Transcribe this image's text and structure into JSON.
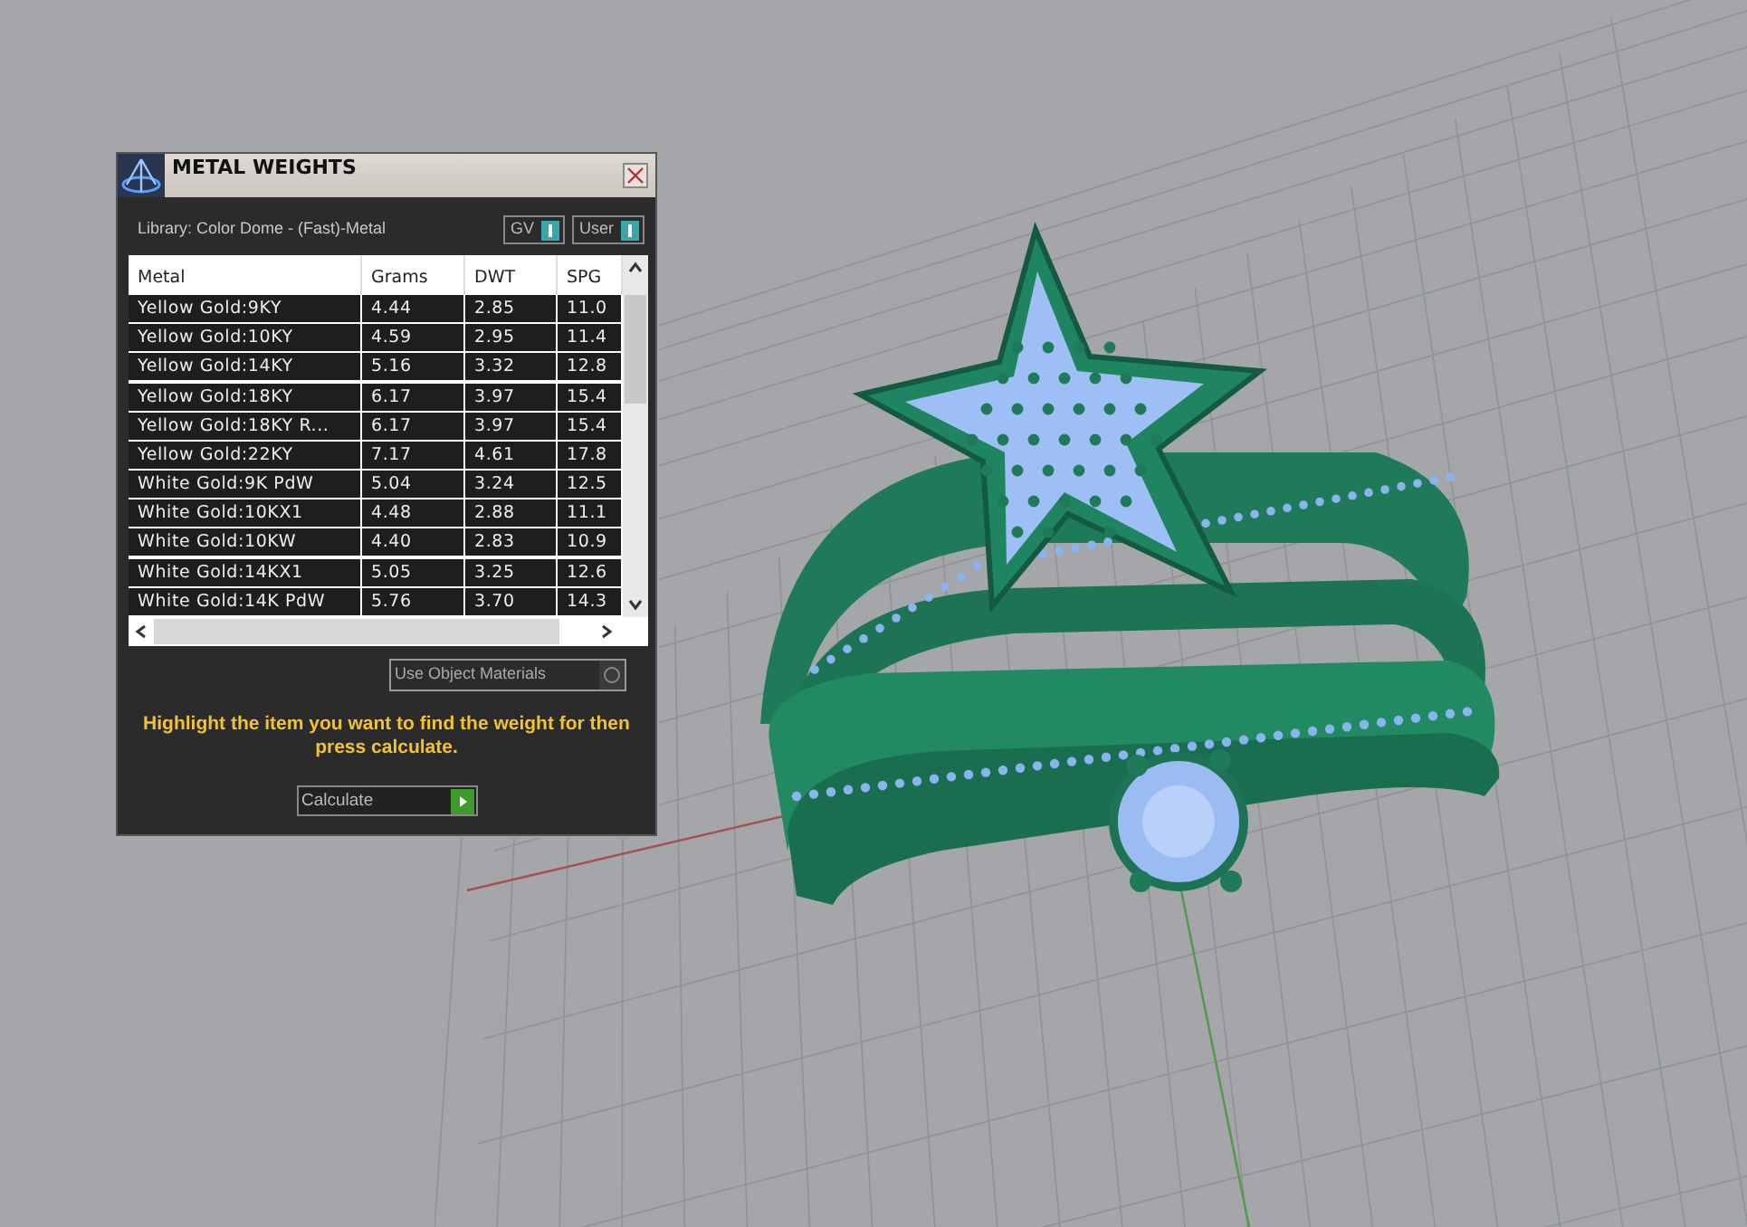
{
  "panel": {
    "title": "METAL WEIGHTS",
    "library": "Library: Color Dome - (Fast)-Metal",
    "toggles": [
      {
        "label": "GV",
        "on": true
      },
      {
        "label": "User",
        "on": true
      }
    ],
    "table": {
      "columns": [
        "Metal",
        "Grams",
        "DWT",
        "SPG"
      ],
      "rows": [
        {
          "cells": [
            "Yellow Gold:9KY",
            "4.44",
            "2.85",
            "11.0"
          ],
          "selected": false
        },
        {
          "cells": [
            "Yellow Gold:10KY",
            "4.59",
            "2.95",
            "11.4"
          ],
          "selected": false
        },
        {
          "cells": [
            "Yellow Gold:14KY",
            "5.16",
            "3.32",
            "12.8"
          ],
          "selected": false
        },
        {
          "cells": [
            "Yellow Gold:18KY",
            "6.17",
            "3.97",
            "15.4"
          ],
          "selected": false
        },
        {
          "cells": [
            "Yellow Gold:18KY R...",
            "6.17",
            "3.97",
            "15.4"
          ],
          "selected": false
        },
        {
          "cells": [
            "Yellow Gold:22KY",
            "7.17",
            "4.61",
            "17.8"
          ],
          "selected": false
        },
        {
          "cells": [
            "White Gold:9K PdW",
            "5.04",
            "3.24",
            "12.5"
          ],
          "selected": false
        },
        {
          "cells": [
            "White Gold:10KX1",
            "4.48",
            "2.88",
            "11.1"
          ],
          "selected": false
        },
        {
          "cells": [
            "White Gold:10KW",
            "4.40",
            "2.83",
            "10.9"
          ],
          "selected": false
        },
        {
          "cells": [
            "White Gold:14KX1",
            "5.05",
            "3.25",
            "12.6"
          ],
          "selected": false
        },
        {
          "cells": [
            "White Gold:14K PdW",
            "5.76",
            "3.70",
            "14.3"
          ],
          "selected": false
        }
      ]
    },
    "use_object_materials": {
      "label": "Use Object Materials",
      "checked": false
    },
    "hint": "Highlight the item you want to find the weight for then press calculate.",
    "calculate": "Calculate"
  }
}
